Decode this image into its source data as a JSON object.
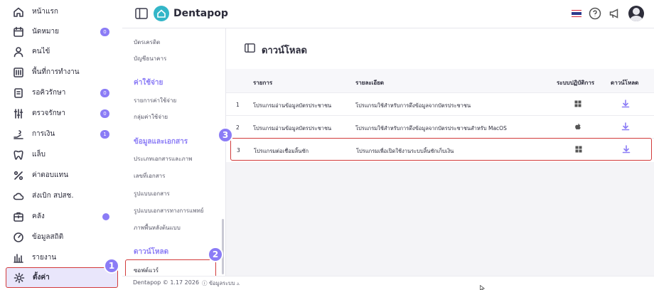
{
  "brand": {
    "name": "Dentapop"
  },
  "nav": [
    {
      "label": "หน้าแรก",
      "icon": "home-icon"
    },
    {
      "label": "นัดหมาย",
      "icon": "calendar-icon",
      "badge": "0"
    },
    {
      "label": "คนไข้",
      "icon": "user-icon"
    },
    {
      "label": "พื้นที่การทำงาน",
      "icon": "workspace-icon"
    },
    {
      "label": "รอคิวรักษา",
      "icon": "queue-icon",
      "badge": "0"
    },
    {
      "label": "ตรวจรักษา",
      "icon": "treatment-icon",
      "badge": "0"
    },
    {
      "label": "การเงิน",
      "icon": "finance-icon",
      "badge": "1"
    },
    {
      "label": "แล็บ",
      "icon": "tooth-icon"
    },
    {
      "label": "ค่าตอบแทน",
      "icon": "percent-icon"
    },
    {
      "label": "ส่งเบิก สปสช.",
      "icon": "cloud-icon"
    },
    {
      "label": "คลัง",
      "icon": "inventory-icon",
      "dot": true
    },
    {
      "label": "ข้อมูลสถิติ",
      "icon": "gauge-icon"
    },
    {
      "label": "รายงาน",
      "icon": "report-icon"
    },
    {
      "label": "ตั้งค่า",
      "icon": "gear-icon",
      "active": true
    }
  ],
  "subnav": {
    "items_top": [
      "บัตรเครดิต",
      "บัญชีธนาคาร"
    ],
    "expense_heading": "ค่าใช้จ่าย",
    "expense_items": [
      "รายการค่าใช้จ่าย",
      "กลุ่มค่าใช้จ่าย"
    ],
    "docs_heading": "ข้อมูลและเอกสาร",
    "docs_items": [
      "ประเภทเอกสารและภาพ",
      "เลขที่เอกสาร",
      "รูปแบบเอกสาร",
      "รูปแบบเอกสารทางการแพทย์",
      "ภาพพื้นหลังต้นแบบ"
    ],
    "download_heading": "ดาวน์โหลด",
    "active_item": "ซอฟต์แวร์"
  },
  "page": {
    "title": "ดาวน์โหลด",
    "columns": {
      "name": "รายการ",
      "detail": "รายละเอียด",
      "os": "ระบบปฏิบัติการ",
      "download": "ดาวน์โหลด"
    },
    "rows": [
      {
        "no": "1",
        "name": "โปรแกรมอ่านข้อมูลบัตรประชาชน",
        "detail": "โปรแกรมใช้สำหรับการดึงข้อมูลจากบัตรประชาชน",
        "os": "windows-icon"
      },
      {
        "no": "2",
        "name": "โปรแกรมอ่านข้อมูลบัตรประชาชน",
        "detail": "โปรแกรมใช้สำหรับการดึงข้อมูลจากบัตรประชาชนสำหรับ MacOS",
        "os": "apple-icon"
      },
      {
        "no": "3",
        "name": "โปรแกรมต่อเชื่อมลิ้นชัก",
        "detail": "โปรแกรมเพื่อเปิดใช้งานระบบลิ้นชักเก็บเงิน",
        "os": "windows-icon"
      }
    ]
  },
  "footer": {
    "version": "Dentapop © 1.17 2026",
    "system_info": "ข้อมูลระบบ"
  },
  "steps": [
    "1",
    "2",
    "3"
  ],
  "colors": {
    "accent": "#8b7cf6",
    "brand": "#33b6c8",
    "highlight": "#d23a3a"
  }
}
